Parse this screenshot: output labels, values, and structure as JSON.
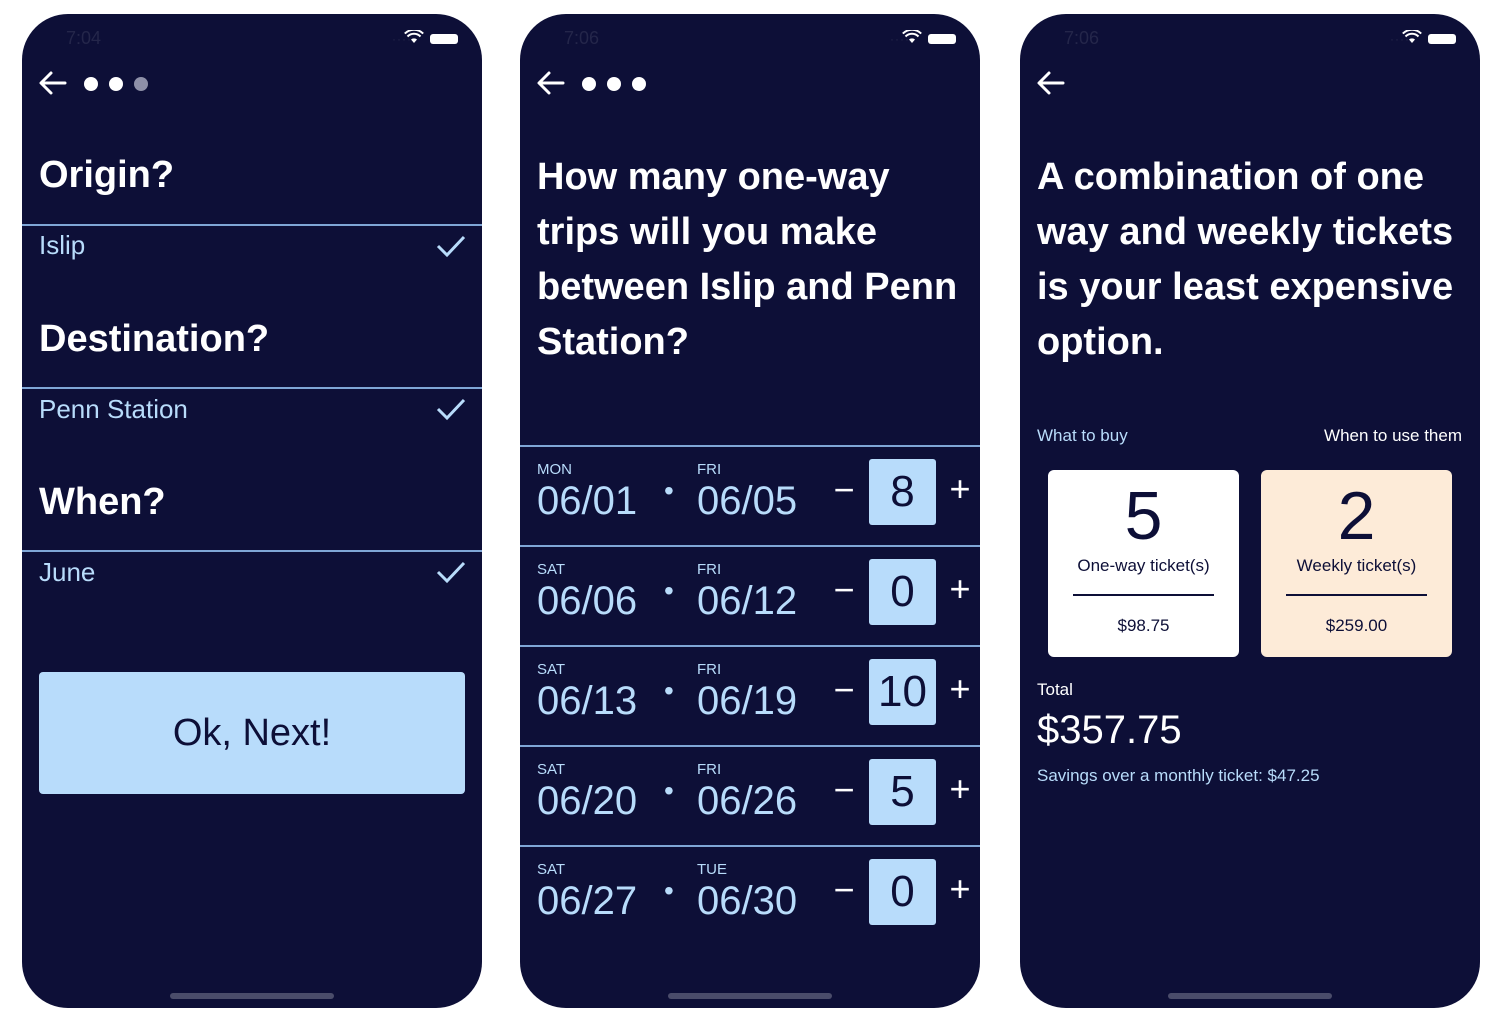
{
  "screens": [
    {
      "time": "7:04",
      "origin": {
        "question": "Origin?",
        "answer": "Islip"
      },
      "destination": {
        "question": "Destination?",
        "answer": "Penn Station"
      },
      "when": {
        "question": "When?",
        "answer": "June"
      },
      "next_button": "Ok, Next!",
      "progress_dots": {
        "total": 3,
        "active": 2
      }
    },
    {
      "time": "7:06",
      "question": "How many one-way trips will you make between Islip and Penn Station?",
      "progress_dots": {
        "total": 3,
        "active": 3
      },
      "minus_label": "−",
      "plus_label": "+",
      "sep": "•",
      "weeks": [
        {
          "start_day": "MON",
          "start_date": "06/01",
          "end_day": "FRI",
          "end_date": "06/05",
          "count": "8"
        },
        {
          "start_day": "SAT",
          "start_date": "06/06",
          "end_day": "FRI",
          "end_date": "06/12",
          "count": "0"
        },
        {
          "start_day": "SAT",
          "start_date": "06/13",
          "end_day": "FRI",
          "end_date": "06/19",
          "count": "10"
        },
        {
          "start_day": "SAT",
          "start_date": "06/20",
          "end_day": "FRI",
          "end_date": "06/26",
          "count": "5"
        },
        {
          "start_day": "SAT",
          "start_date": "06/27",
          "end_day": "TUE",
          "end_date": "06/30",
          "count": "0"
        }
      ]
    },
    {
      "time": "7:06",
      "headline": "A combination of one way and weekly tickets is your least expensive option.",
      "what_to_buy": "What to buy",
      "when_to_use": "When to use them",
      "cards": [
        {
          "count": "5",
          "label": "One-way ticket(s)",
          "price": "$98.75"
        },
        {
          "count": "2",
          "label": "Weekly ticket(s)",
          "price": "$259.00"
        }
      ],
      "total_label": "Total",
      "total_value": "$357.75",
      "savings": "Savings over a monthly ticket: $47.25"
    }
  ],
  "colors": {
    "background": "#0d0f37",
    "accent": "#b8dcfb",
    "divider": "#7fa6d6",
    "weekly_card": "#fdebd8"
  },
  "icons": [
    "back-arrow-icon",
    "checkmark-icon",
    "wifi-icon",
    "battery-icon",
    "signal-icon"
  ]
}
